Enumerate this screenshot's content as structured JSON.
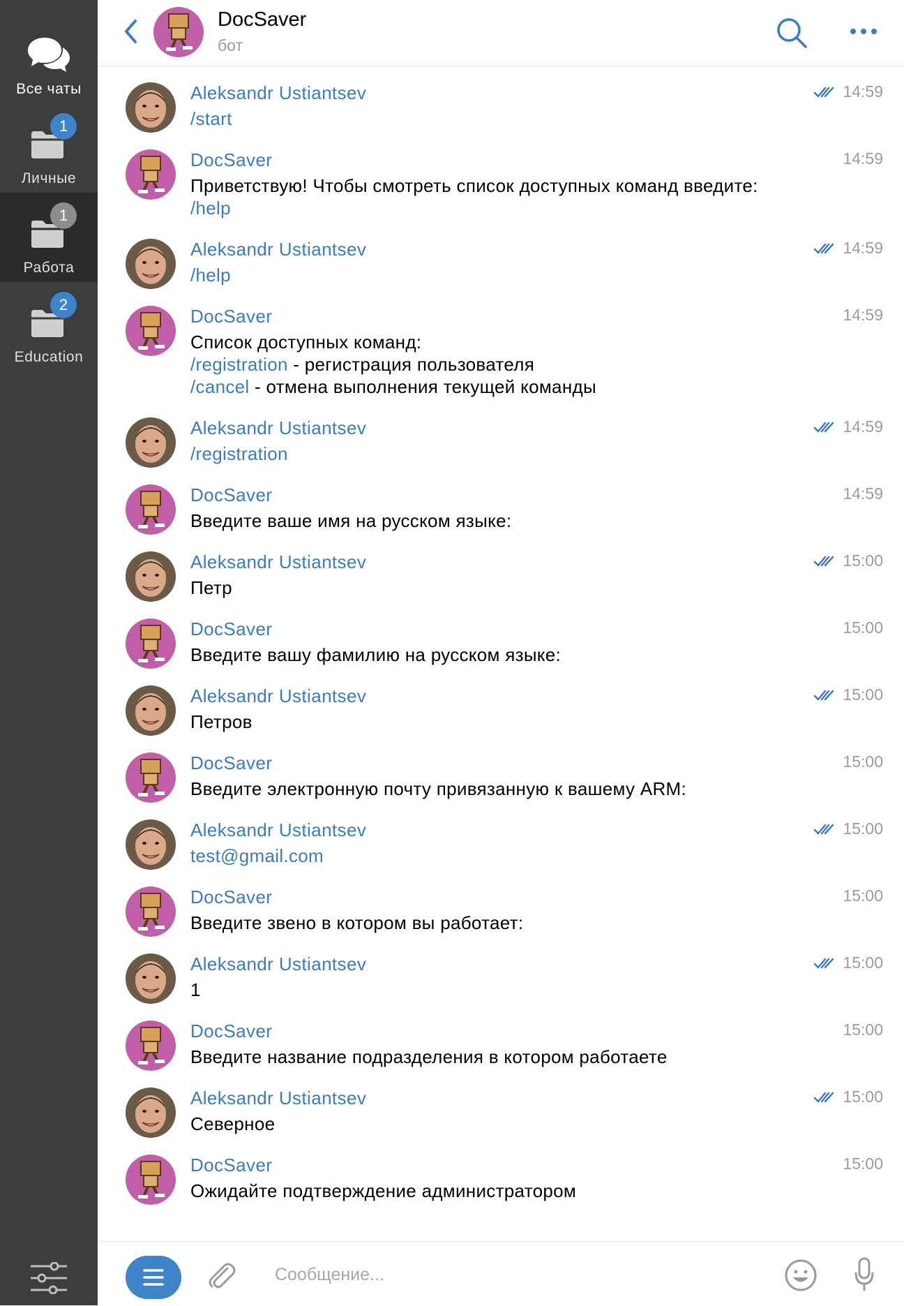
{
  "sidebar": {
    "all_chats_label": "Все чаты",
    "folders": [
      {
        "label": "Личные",
        "badge": "1",
        "badge_color": "#3d84c8"
      },
      {
        "label": "Работа",
        "badge": "1",
        "badge_color": "#8d8d8d"
      },
      {
        "label": "Education",
        "badge": "2",
        "badge_color": "#3d84c8"
      }
    ]
  },
  "header": {
    "title": "DocSaver",
    "subtitle": "бот"
  },
  "messages": [
    {
      "sender": "Aleksandr Ustiantsev",
      "time": "14:59",
      "kind": "user",
      "read": true,
      "lines": [
        [
          {
            "t": "/start",
            "cmd": true
          }
        ]
      ]
    },
    {
      "sender": "DocSaver",
      "time": "14:59",
      "kind": "bot",
      "read": false,
      "lines": [
        [
          {
            "t": "Приветствую! Чтобы смотреть список доступных команд введите: ",
            "cmd": false
          },
          {
            "t": "/help",
            "cmd": true
          }
        ]
      ]
    },
    {
      "sender": "Aleksandr Ustiantsev",
      "time": "14:59",
      "kind": "user",
      "read": true,
      "lines": [
        [
          {
            "t": "/help",
            "cmd": true
          }
        ]
      ]
    },
    {
      "sender": "DocSaver",
      "time": "14:59",
      "kind": "bot",
      "read": false,
      "lines": [
        [
          {
            "t": "Список доступных команд:",
            "cmd": false
          }
        ],
        [
          {
            "t": "/registration",
            "cmd": true
          },
          {
            "t": " - регистрация пользователя",
            "cmd": false
          }
        ],
        [
          {
            "t": "/cancel",
            "cmd": true
          },
          {
            "t": " - отмена выполнения текущей команды",
            "cmd": false
          }
        ]
      ]
    },
    {
      "sender": "Aleksandr Ustiantsev",
      "time": "14:59",
      "kind": "user",
      "read": true,
      "lines": [
        [
          {
            "t": "/registration",
            "cmd": true
          }
        ]
      ]
    },
    {
      "sender": "DocSaver",
      "time": "14:59",
      "kind": "bot",
      "read": false,
      "lines": [
        [
          {
            "t": "Введите ваше имя на русском языке:",
            "cmd": false
          }
        ]
      ]
    },
    {
      "sender": "Aleksandr Ustiantsev",
      "time": "15:00",
      "kind": "user",
      "read": true,
      "lines": [
        [
          {
            "t": "Петр",
            "cmd": false
          }
        ]
      ]
    },
    {
      "sender": "DocSaver",
      "time": "15:00",
      "kind": "bot",
      "read": false,
      "lines": [
        [
          {
            "t": "Введите вашу фамилию на русском языке:",
            "cmd": false
          }
        ]
      ]
    },
    {
      "sender": "Aleksandr Ustiantsev",
      "time": "15:00",
      "kind": "user",
      "read": true,
      "lines": [
        [
          {
            "t": "Петров",
            "cmd": false
          }
        ]
      ]
    },
    {
      "sender": "DocSaver",
      "time": "15:00",
      "kind": "bot",
      "read": false,
      "lines": [
        [
          {
            "t": "Введите электронную почту привязанную к вашему ARM:",
            "cmd": false
          }
        ]
      ]
    },
    {
      "sender": "Aleksandr Ustiantsev",
      "time": "15:00",
      "kind": "user",
      "read": true,
      "lines": [
        [
          {
            "t": "test@gmail.com",
            "cmd": true
          }
        ]
      ]
    },
    {
      "sender": "DocSaver",
      "time": "15:00",
      "kind": "bot",
      "read": false,
      "lines": [
        [
          {
            "t": "Введите звено в котором вы работает:",
            "cmd": false
          }
        ]
      ]
    },
    {
      "sender": "Aleksandr Ustiantsev",
      "time": "15:00",
      "kind": "user",
      "read": true,
      "lines": [
        [
          {
            "t": "1",
            "cmd": false
          }
        ]
      ]
    },
    {
      "sender": "DocSaver",
      "time": "15:00",
      "kind": "bot",
      "read": false,
      "lines": [
        [
          {
            "t": "Введите название подразделения в котором работаете",
            "cmd": false
          }
        ]
      ]
    },
    {
      "sender": "Aleksandr Ustiantsev",
      "time": "15:00",
      "kind": "user",
      "read": true,
      "lines": [
        [
          {
            "t": "Северное",
            "cmd": false
          }
        ]
      ]
    },
    {
      "sender": "DocSaver",
      "time": "15:00",
      "kind": "bot",
      "read": false,
      "lines": [
        [
          {
            "t": "Ожидайте подтверждение администратором",
            "cmd": false
          }
        ]
      ]
    }
  ],
  "composer": {
    "placeholder": "Сообщение..."
  },
  "colors": {
    "accent": "#3a7cbd",
    "bot_avatar": "#c05fa8",
    "sidebar_bg": "#3d3d3d"
  }
}
